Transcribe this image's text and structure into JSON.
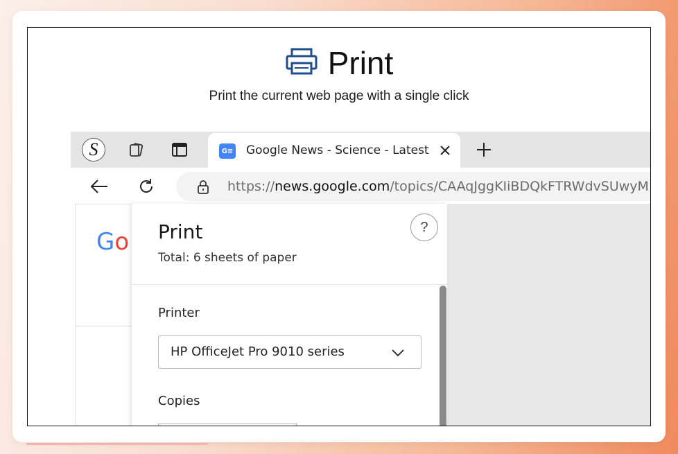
{
  "hero": {
    "title": "Print",
    "subtitle": "Print the current web page with a single click",
    "icon": "printer-icon"
  },
  "browser": {
    "profile_initial": "S",
    "tab": {
      "favicon_text": "G≡",
      "title": "Google News - Science - Latest"
    },
    "url": {
      "scheme": "https://",
      "host": "news.google.com",
      "path": "/topics/CAAqJggKIiBDQkFTRWdvSUwyM"
    },
    "page_logo": "Go"
  },
  "print_panel": {
    "title": "Print",
    "summary": "Total: 6 sheets of paper",
    "help_label": "?",
    "printer_label": "Printer",
    "printer_selected": "HP OfficeJet Pro 9010 series",
    "copies_label": "Copies"
  },
  "colors": {
    "accent_blue": "#1f4e8c",
    "google_blue": "#4285f4",
    "google_red": "#ea4335"
  }
}
